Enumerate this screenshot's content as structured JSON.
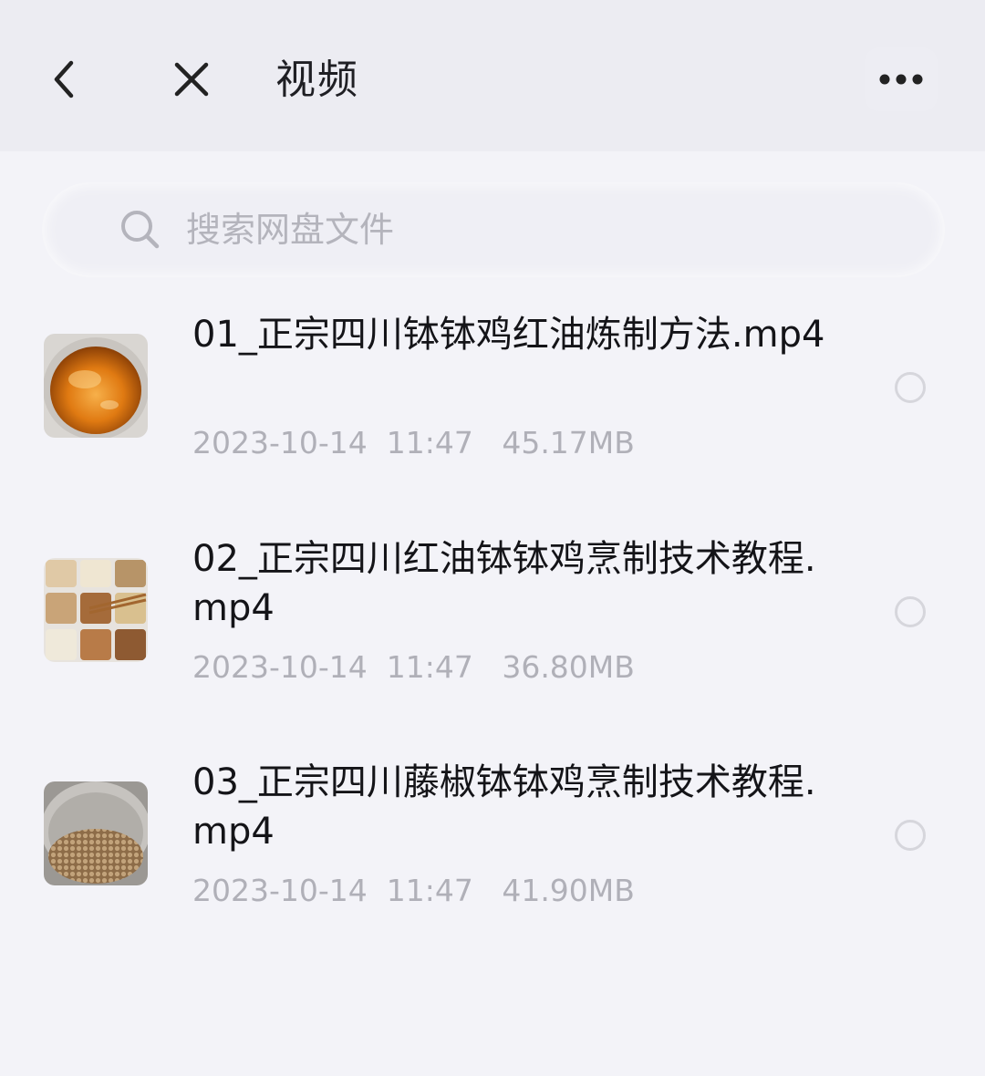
{
  "header": {
    "title": "视频",
    "back_icon": "chevron-left-icon",
    "close_icon": "close-icon",
    "more_icon": "more-horizontal-icon"
  },
  "search": {
    "placeholder": "搜索网盘文件",
    "value": "",
    "icon": "search-icon"
  },
  "files": [
    {
      "name": "01_正宗四川钵钵鸡红油炼制方法.mp4",
      "meta": "2023-10-14  11:47   45.17MB",
      "thumb": "red-oil-pot-thumbnail"
    },
    {
      "name": "02_正宗四川红油钵钵鸡烹制技术教程.mp4",
      "meta": "2023-10-14  11:47   36.80MB",
      "thumb": "spices-tray-thumbnail"
    },
    {
      "name": "03_正宗四川藤椒钵钵鸡烹制技术教程.mp4",
      "meta": "2023-10-14  11:47   41.90MB",
      "thumb": "peppercorn-bowl-thumbnail"
    }
  ],
  "colors": {
    "background": "#f3f3f8",
    "header": "#ececf2",
    "text_primary": "#141418",
    "text_secondary": "#b0b0b8"
  }
}
